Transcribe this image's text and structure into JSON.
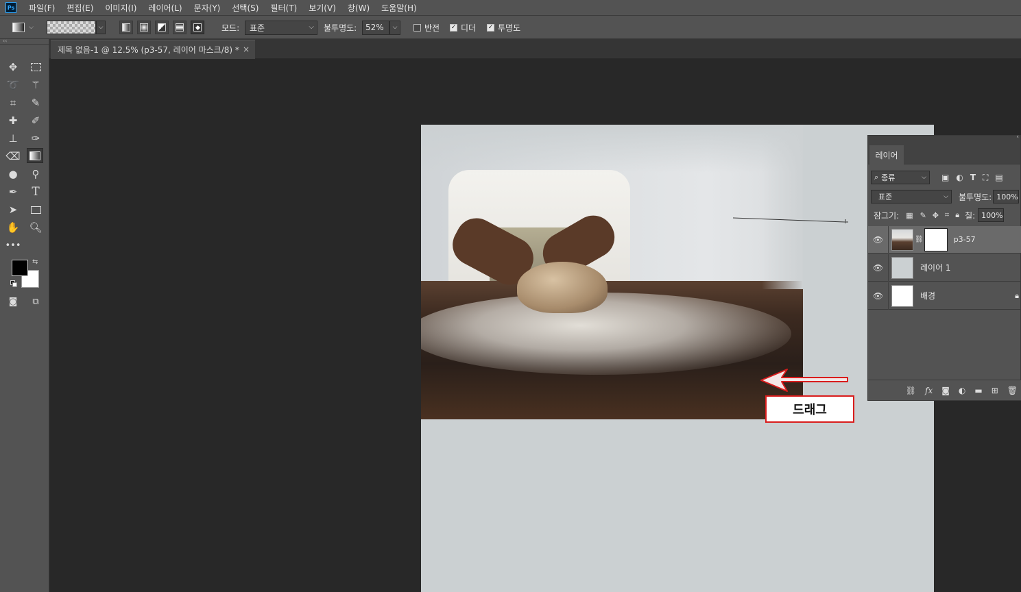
{
  "menubar": {
    "logo": "Ps",
    "items": [
      "파일(F)",
      "편집(E)",
      "이미지(I)",
      "레이어(L)",
      "문자(Y)",
      "선택(S)",
      "필터(T)",
      "보기(V)",
      "창(W)",
      "도움말(H)"
    ]
  },
  "options": {
    "mode_label": "모드:",
    "mode_value": "표준",
    "opacity_label": "불투명도:",
    "opacity_value": "52%",
    "reverse_label": "반전",
    "dither_label": "디더",
    "transparency_label": "투명도",
    "reverse_checked": false,
    "dither_checked": true,
    "transparency_checked": true
  },
  "document": {
    "tab_title": "제목 없음-1 @ 12.5% (p3-57, 레이어 마스크/8) *",
    "close": "×"
  },
  "annotation": {
    "drag_label": "드래그",
    "color": "#d91c1c"
  },
  "layers_panel": {
    "tab": "레이어",
    "filter_label": "종류",
    "blend_mode": "표준",
    "opacity_label": "불투명도:",
    "opacity_value": "100%",
    "lock_label": "잠그기:",
    "fill_label": "칠:",
    "fill_value": "100%",
    "layers": [
      {
        "name": "p3-57",
        "selected": true
      },
      {
        "name": "레이어 1",
        "selected": false
      },
      {
        "name": "배경",
        "selected": false,
        "locked": true
      }
    ]
  },
  "colors": {
    "foreground": "#000000",
    "background": "#ffffff",
    "canvas": "#cbd0d2"
  }
}
